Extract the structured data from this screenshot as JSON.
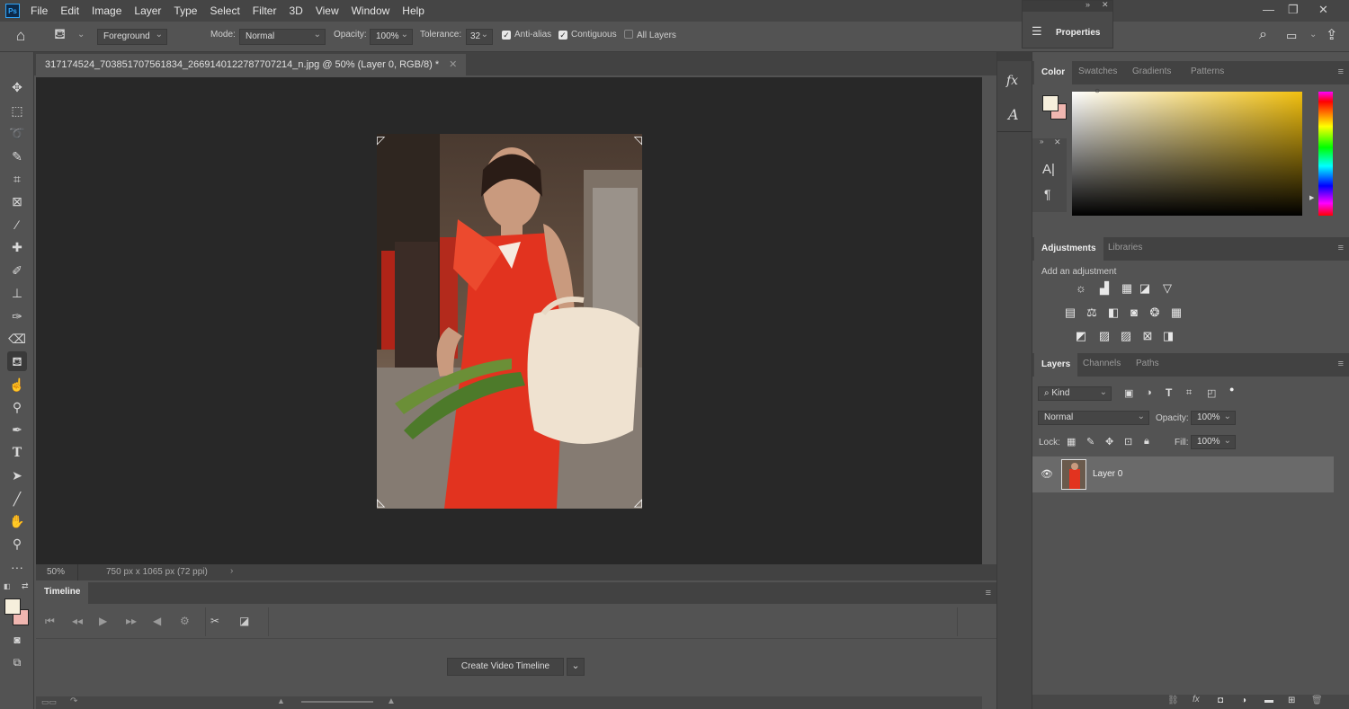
{
  "menubar": {
    "logo": "Ps",
    "items": [
      "File",
      "Edit",
      "Image",
      "Layer",
      "Type",
      "Select",
      "Filter",
      "3D",
      "View",
      "Window",
      "Help"
    ]
  },
  "options": {
    "fill_source": "Foreground",
    "mode_label": "Mode:",
    "mode_value": "Normal",
    "opacity_label": "Opacity:",
    "opacity_value": "100%",
    "tolerance_label": "Tolerance:",
    "tolerance_value": "32",
    "anti_alias": "Anti-alias",
    "contiguous": "Contiguous",
    "all_layers": "All Layers"
  },
  "properties_panel": {
    "title": "Properties"
  },
  "document": {
    "tab_title": "317174524_703851707561834_2669140122787707214_n.jpg @ 50% (Layer 0, RGB/8) *",
    "zoom": "50%",
    "doc_info": "750 px x 1065 px (72 ppi)"
  },
  "timeline": {
    "title": "Timeline",
    "create_button": "Create Video Timeline"
  },
  "color_panel": {
    "tabs": [
      "Color",
      "Swatches",
      "Gradients",
      "Patterns"
    ],
    "foreground": "#f6efdc",
    "background": "#f0b6b0"
  },
  "adjustments_panel": {
    "tabs": [
      "Adjustments",
      "Libraries"
    ],
    "hint": "Add an adjustment"
  },
  "layers_panel": {
    "tabs": [
      "Layers",
      "Channels",
      "Paths"
    ],
    "kind_label": "Kind",
    "blend_mode": "Normal",
    "opacity_label": "Opacity:",
    "opacity_value": "100%",
    "lock_label": "Lock:",
    "fill_label": "Fill:",
    "fill_value": "100%",
    "layers": [
      {
        "name": "Layer 0",
        "visible": true
      }
    ]
  },
  "colors": {
    "app_bg": "#535353",
    "canvas_bg": "#282828",
    "dress_red": "#e2331f"
  }
}
